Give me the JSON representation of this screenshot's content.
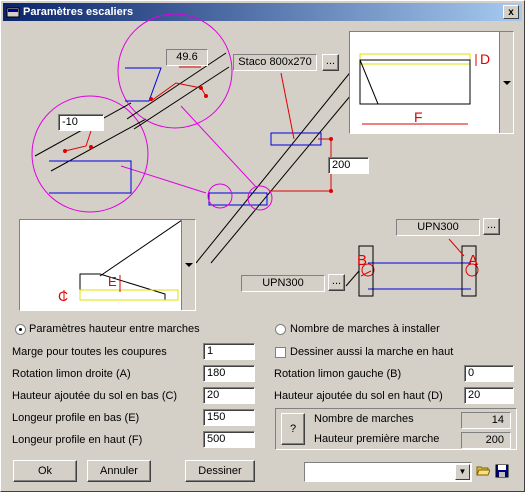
{
  "window": {
    "title": "Paramètres escaliers",
    "close_glyph": "x"
  },
  "diagram": {
    "top_zoom_value": "49.6",
    "left_zoom_value": "-10",
    "profile_top_label": "Staco 800x270",
    "profile_dim_value": "200",
    "profile_right_top_label": "UPN300",
    "profile_right_bottom_label": "UPN300",
    "browse_glyph": "...",
    "letter_d": "D",
    "letter_f": "F",
    "letter_e": "E",
    "letter_c": "C",
    "letter_b": "B",
    "letter_a": "A"
  },
  "form": {
    "radio_height_label": "Paramètres hauteur entre marches",
    "radio_steps_label": "Nombre de marches à installer",
    "check_top_step_label": "Dessiner aussi la marche en haut",
    "marge_label": "Marge pour toutes les coupures",
    "marge_value": "1",
    "rot_droite_label": "Rotation limon droite (A)",
    "rot_droite_value": "180",
    "rot_gauche_label": "Rotation limon gauche (B)",
    "rot_gauche_value": "0",
    "haut_bas_label": "Hauteur ajoutée du sol en bas (C)",
    "haut_bas_value": "20",
    "haut_haut_label": "Hauteur ajoutée du sol en haut (D)",
    "haut_haut_value": "20",
    "long_bas_label": "Longeur profile en bas (E)",
    "long_bas_value": "150",
    "long_haut_label": "Longeur profile en haut (F)",
    "long_haut_value": "500",
    "help_glyph": "?",
    "nb_marches_label": "Nombre de marches",
    "nb_marches_value": "14",
    "hauteur_premiere_label": "Hauteur première marche",
    "hauteur_premiere_value": "200"
  },
  "footer": {
    "ok_label": "Ok",
    "cancel_label": "Annuler",
    "draw_label": "Dessiner",
    "preset_value": "",
    "combo_arrow": "▼"
  },
  "colors": {
    "magenta": "#e000e0",
    "red": "#e00000",
    "blue": "#0000e0",
    "yellow": "#e0e000"
  }
}
